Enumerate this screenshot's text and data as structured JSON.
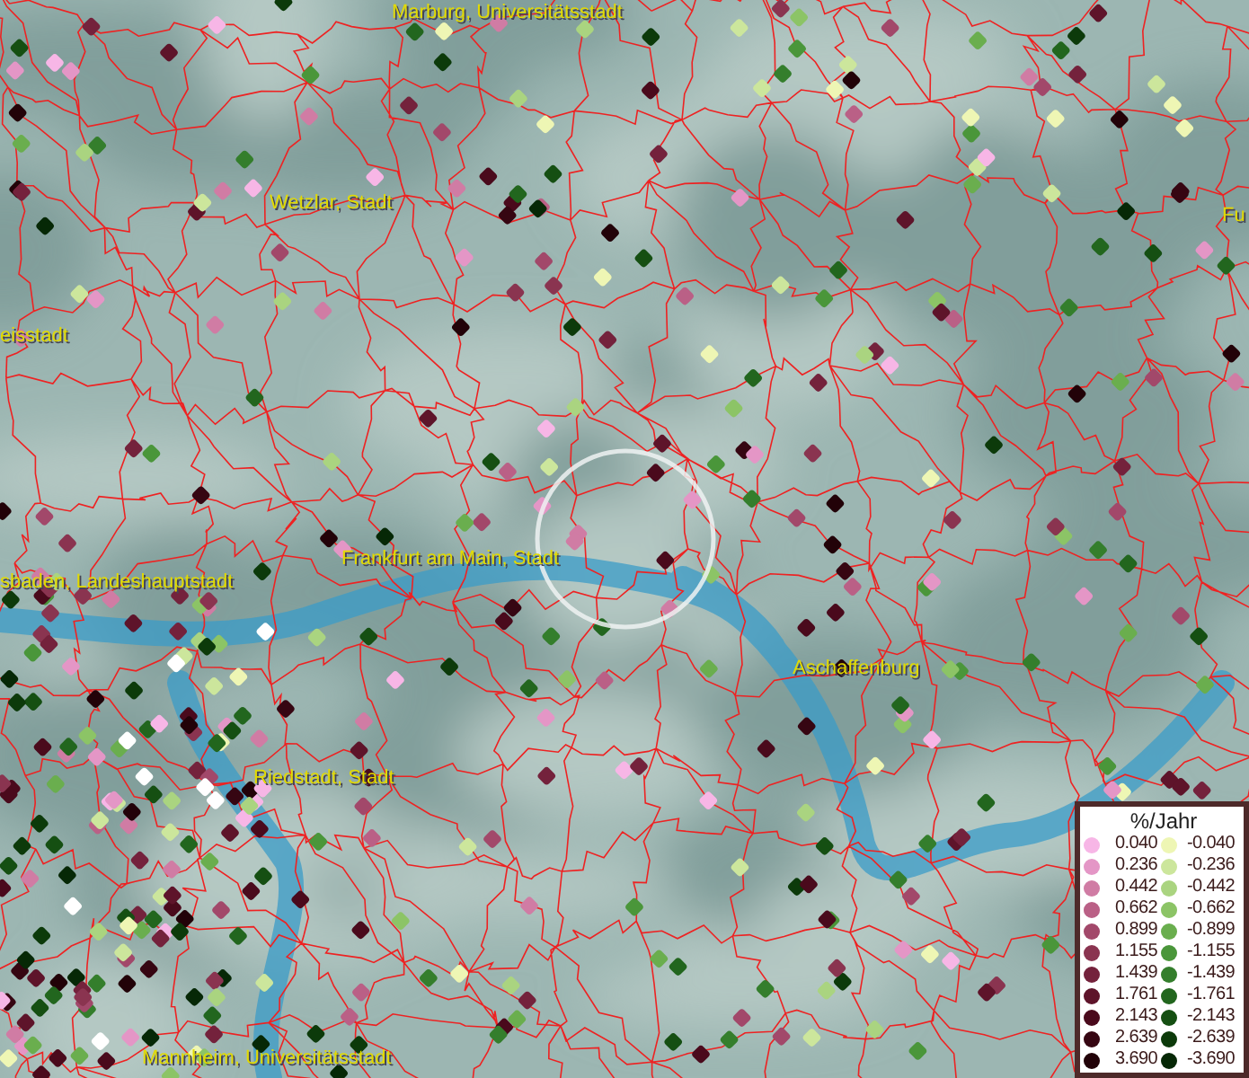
{
  "map_labels": [
    {
      "text": "Marburg, Universitätsstadt"
    },
    {
      "text": "Wetzlar, Stadt"
    },
    {
      "text": "eisstadt"
    },
    {
      "text": "Fu"
    },
    {
      "text": "Frankfurt am Main, Stadt"
    },
    {
      "text": "sbaden, Landeshauptstadt"
    },
    {
      "text": "Aschaffenburg"
    },
    {
      "text": "Riedstadt, Stadt"
    },
    {
      "text": "Mannheim, Universitätsstadt"
    }
  ],
  "legend": {
    "title": "%/Jahr",
    "columns": [
      [
        {
          "label": "0.040",
          "color": "#f7b6e6"
        },
        {
          "label": "0.236",
          "color": "#e496c6"
        },
        {
          "label": "0.442",
          "color": "#d07ca4"
        },
        {
          "label": "0.662",
          "color": "#ba6086"
        },
        {
          "label": "0.899",
          "color": "#a2486a"
        },
        {
          "label": "1.155",
          "color": "#8a3450"
        },
        {
          "label": "1.439",
          "color": "#74223c"
        },
        {
          "label": "1.761",
          "color": "#5e142a"
        },
        {
          "label": "2.143",
          "color": "#4a0a1c"
        },
        {
          "label": "2.639",
          "color": "#360612"
        },
        {
          "label": "3.690",
          "color": "#220208"
        }
      ],
      [
        {
          "label": "-0.040",
          "color": "#eef6b4"
        },
        {
          "label": "-0.236",
          "color": "#cce69c"
        },
        {
          "label": "-0.442",
          "color": "#aad480"
        },
        {
          "label": "-0.662",
          "color": "#8cc466"
        },
        {
          "label": "-0.899",
          "color": "#6aae4e"
        },
        {
          "label": "-1.155",
          "color": "#4a963a"
        },
        {
          "label": "-1.439",
          "color": "#347e2c"
        },
        {
          "label": "-1.761",
          "color": "#22661e"
        },
        {
          "label": "-2.143",
          "color": "#154f12"
        },
        {
          "label": "-2.639",
          "color": "#0c3a0a"
        },
        {
          "label": "-3.690",
          "color": "#062806"
        }
      ]
    ]
  }
}
